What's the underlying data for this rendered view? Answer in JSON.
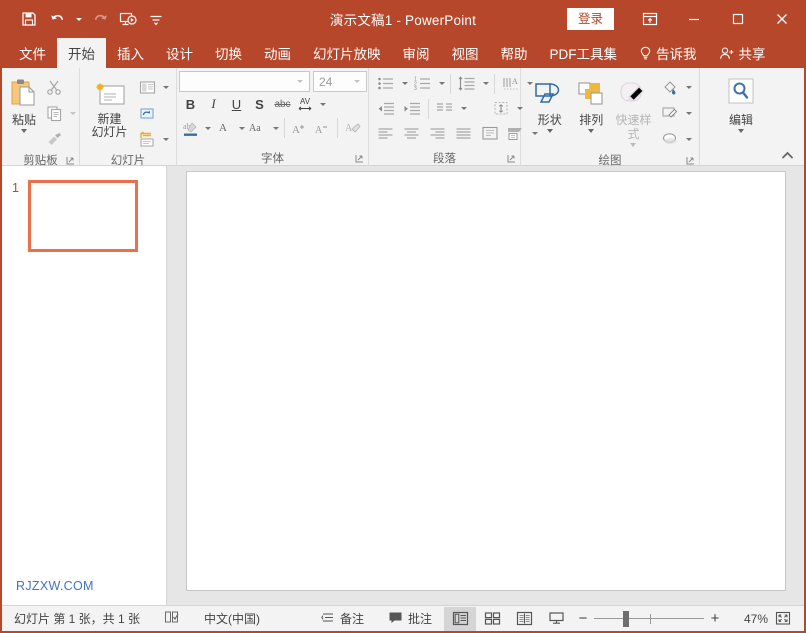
{
  "window": {
    "title": "演示文稿1  -  PowerPoint",
    "signin_label": "登录",
    "quick_access": [
      {
        "name": "save-icon",
        "label": "保存"
      },
      {
        "name": "undo-icon",
        "label": "撤消"
      },
      {
        "name": "redo-icon",
        "label": "恢复"
      },
      {
        "name": "start-slideshow-icon",
        "label": "从头开始"
      },
      {
        "name": "customize-qat-icon",
        "label": "自定义快速访问工具栏"
      }
    ],
    "controls": [
      {
        "name": "ribbon-display-options-button",
        "label": "功能区显示选项"
      },
      {
        "name": "minimize-button",
        "label": "最小化"
      },
      {
        "name": "maximize-button",
        "label": "最大化"
      },
      {
        "name": "close-button",
        "label": "关闭"
      }
    ]
  },
  "tabs": [
    {
      "label": "文件",
      "active": false
    },
    {
      "label": "开始",
      "active": true
    },
    {
      "label": "插入",
      "active": false
    },
    {
      "label": "设计",
      "active": false
    },
    {
      "label": "切换",
      "active": false
    },
    {
      "label": "动画",
      "active": false
    },
    {
      "label": "幻灯片放映",
      "active": false
    },
    {
      "label": "审阅",
      "active": false
    },
    {
      "label": "视图",
      "active": false
    },
    {
      "label": "帮助",
      "active": false
    },
    {
      "label": "PDF工具集",
      "active": false
    }
  ],
  "tell_me": {
    "label": "告诉我",
    "icon": "lightbulb-icon"
  },
  "share": {
    "label": "共享",
    "icon": "person-share-icon"
  },
  "ribbon": {
    "groups": [
      {
        "name": "clipboard",
        "label": "剪贴板",
        "paste": {
          "label": "粘贴",
          "icon": "paste-icon"
        },
        "small": [
          {
            "label": "剪切",
            "icon": "cut-scissors-icon"
          },
          {
            "label": "复制",
            "icon": "copy-icon"
          },
          {
            "label": "格式刷",
            "icon": "format-painter-icon"
          }
        ]
      },
      {
        "name": "slides",
        "label": "幻灯片",
        "new_slide": {
          "label": "新建\n幻灯片",
          "line1": "新建",
          "line2": "幻灯片",
          "icon": "new-slide-icon"
        },
        "small": [
          {
            "label": "版式",
            "icon": "layout-icon"
          },
          {
            "label": "重置",
            "icon": "reset-slide-icon"
          },
          {
            "label": "节",
            "icon": "section-icon"
          }
        ]
      },
      {
        "name": "font",
        "label": "字体",
        "font_name": {
          "value": "",
          "placeholder": ""
        },
        "font_size": {
          "value": "24"
        },
        "buttons": [
          {
            "label": "B",
            "name": "bold-button"
          },
          {
            "label": "I",
            "name": "italic-button"
          },
          {
            "label": "U",
            "name": "underline-button"
          },
          {
            "label": "S",
            "name": "text-shadow-button"
          },
          {
            "label": "abc",
            "name": "strikethrough-button"
          },
          {
            "label": "AV",
            "name": "character-spacing-icon"
          }
        ],
        "row2": [
          {
            "name": "text-highlight-icon",
            "label": "文本突出显示颜色"
          },
          {
            "name": "font-color-icon",
            "label": "字体颜色"
          },
          {
            "name": "change-case-icon",
            "label": "更改大小写"
          },
          {
            "name": "increase-font-size-icon",
            "label": "增大字号"
          },
          {
            "name": "decrease-font-size-icon",
            "label": "减小字号"
          },
          {
            "name": "clear-formatting-icon",
            "label": "清除所有格式"
          }
        ]
      },
      {
        "name": "paragraph",
        "label": "段落",
        "row1": [
          "bullets-icon",
          "numbering-icon",
          "line-spacing-icon",
          "text-direction-icon"
        ],
        "row2": [
          "decrease-indent-icon",
          "increase-indent-icon",
          "columns-icon",
          "align-text-icon"
        ],
        "row3": [
          "align-left-icon",
          "align-center-icon",
          "align-right-icon",
          "justify-icon",
          "text-box-icon",
          "smartart-icon"
        ]
      },
      {
        "name": "drawing",
        "label": "绘图",
        "shapes": {
          "label": "形状",
          "icon": "shapes-icon"
        },
        "arrange": {
          "label": "排列",
          "icon": "arrange-icon"
        },
        "quick_styles": {
          "label": "快速样式",
          "icon": "quick-styles-icon",
          "disabled": true
        },
        "small": [
          {
            "name": "shape-fill-icon",
            "label": "形状填充"
          },
          {
            "name": "shape-outline-icon",
            "label": "形状轮廓"
          },
          {
            "name": "shape-effects-icon",
            "label": "形状效果"
          }
        ]
      },
      {
        "name": "editing",
        "label": "编辑",
        "edit": {
          "label": "编辑",
          "icon": "magnifier-icon"
        }
      }
    ],
    "collapse": {
      "name": "collapse-ribbon-icon",
      "label": "折叠功能区"
    }
  },
  "slides_panel": {
    "thumbnails": [
      {
        "number": "1",
        "selected": true
      }
    ],
    "watermark": "RJZXW.COM"
  },
  "status_bar": {
    "slide_count_text": "幻灯片 第 1 张，共 1 张",
    "proofing_icon": "proofing-icon",
    "language": "中文(中国)",
    "notes": {
      "label": "备注",
      "icon": "notes-icon"
    },
    "comments": {
      "label": "批注",
      "icon": "comment-icon"
    },
    "views": [
      {
        "name": "normal-view-button",
        "label": "普通视图",
        "active": true
      },
      {
        "name": "slide-sorter-view-button",
        "label": "幻灯片浏览",
        "active": false
      },
      {
        "name": "reading-view-button",
        "label": "阅读视图",
        "active": false
      },
      {
        "name": "slideshow-view-button",
        "label": "幻灯片放映",
        "active": false
      }
    ],
    "zoom": {
      "out_label": "−",
      "in_label": "+",
      "percent": "47%",
      "fit_label": "使幻灯片适应当前窗口"
    }
  },
  "colors": {
    "brand": "#b7472a",
    "ribbon_bg": "#f3f3f3",
    "canvas_bg": "#e6e6e6",
    "thumb_border": "#e8704a",
    "watermark": "#4472c4"
  }
}
